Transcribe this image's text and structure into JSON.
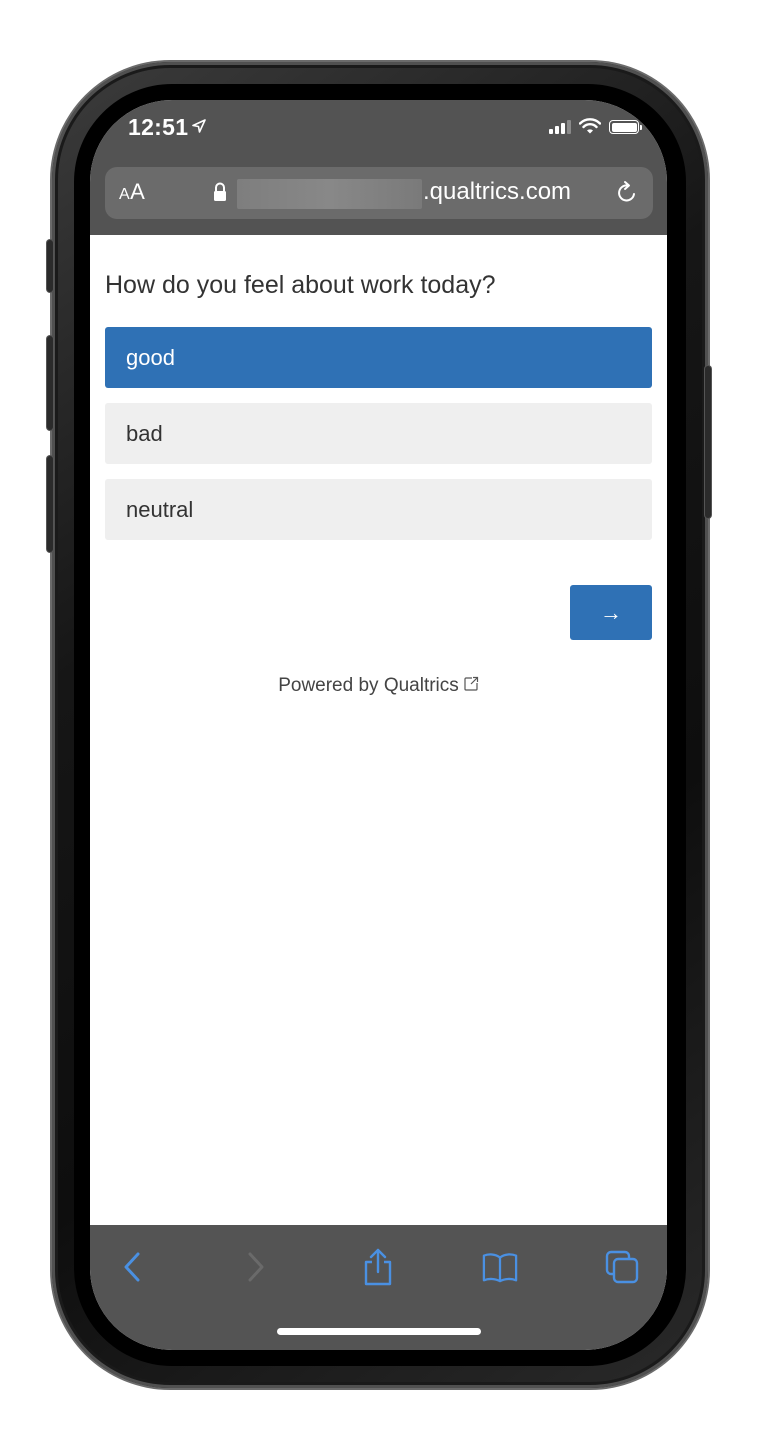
{
  "status_bar": {
    "time": "12:51"
  },
  "browser": {
    "text_size_button_small": "A",
    "text_size_button_large": "A",
    "url_domain": ".qualtrics.com"
  },
  "survey": {
    "question": "How do you feel about work today?",
    "choices": [
      {
        "label": "good",
        "selected": true
      },
      {
        "label": "bad",
        "selected": false
      },
      {
        "label": "neutral",
        "selected": false
      }
    ],
    "next_button": "→",
    "footer": "Powered by Qualtrics"
  },
  "toolbar": {
    "icons": [
      "back-icon",
      "forward-icon",
      "share-icon",
      "bookmarks-icon",
      "tabs-icon"
    ]
  },
  "colors": {
    "accent": "#2f71b5",
    "choice_bg": "#efefef",
    "chrome_bg": "#535353",
    "toolbar_icon": "#4a90e2"
  }
}
